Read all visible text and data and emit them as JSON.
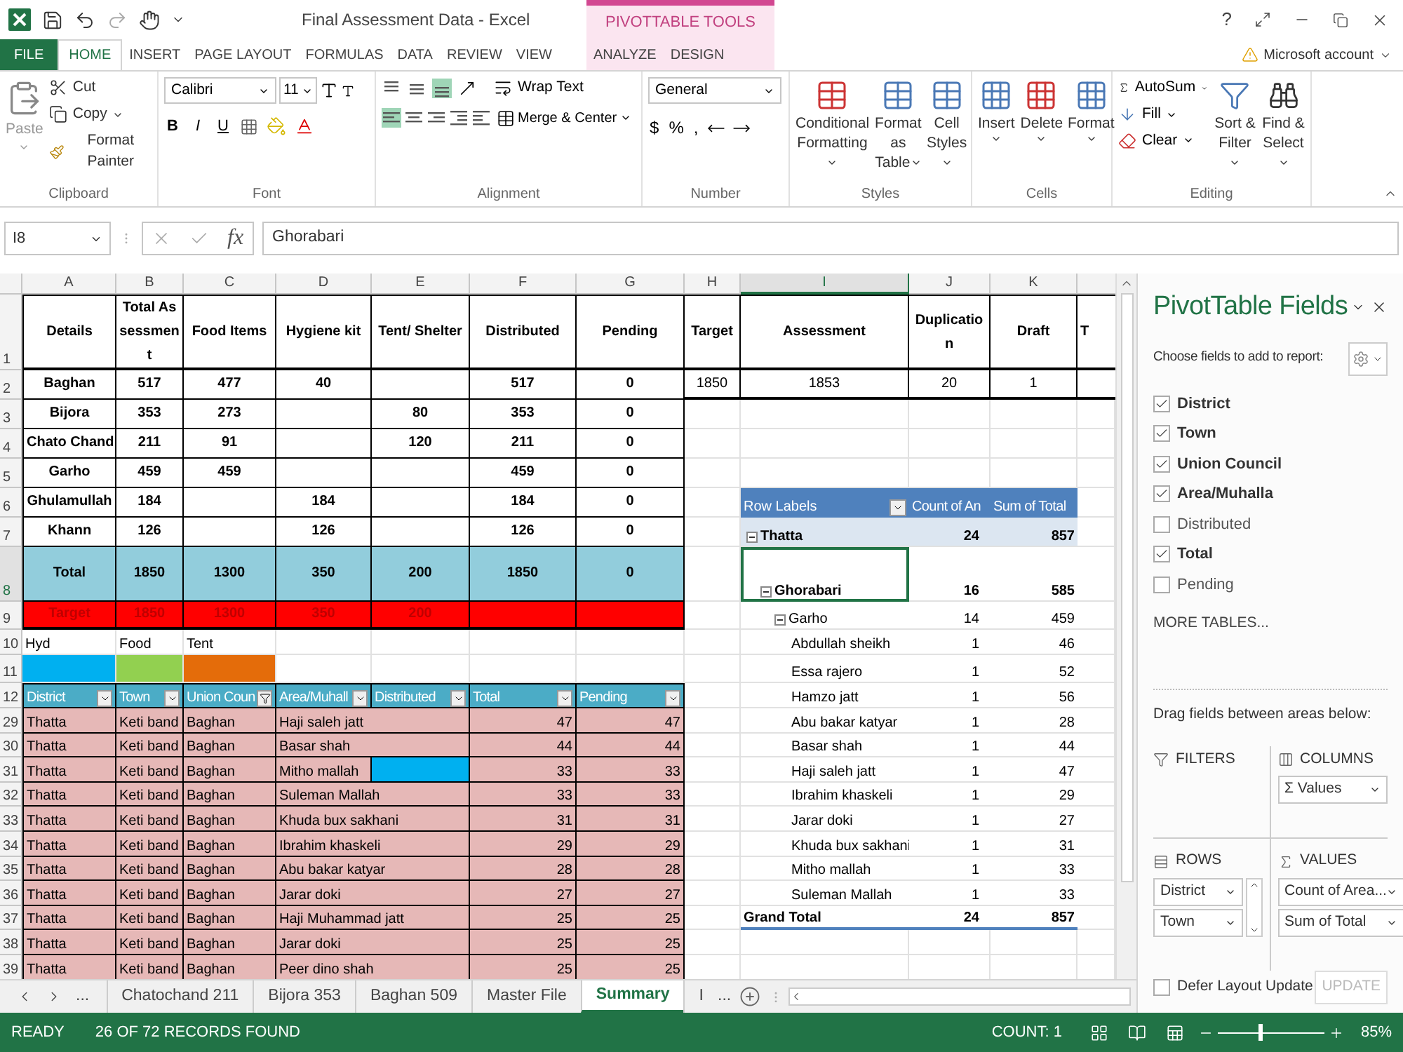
{
  "app": {
    "title": "Final Assessment Data - Excel",
    "contextual_label": "PIVOTTABLE TOOLS",
    "help": "?",
    "account": "Microsoft account"
  },
  "tabs": [
    {
      "label": "FILE",
      "kind": "file",
      "selected": false
    },
    {
      "label": "HOME",
      "kind": "tab",
      "selected": true
    },
    {
      "label": "INSERT",
      "kind": "tab",
      "selected": false
    },
    {
      "label": "PAGE LAYOUT",
      "kind": "tab",
      "selected": false
    },
    {
      "label": "FORMULAS",
      "kind": "tab",
      "selected": false
    },
    {
      "label": "DATA",
      "kind": "tab",
      "selected": false
    },
    {
      "label": "REVIEW",
      "kind": "tab",
      "selected": false
    },
    {
      "label": "VIEW",
      "kind": "tab",
      "selected": false
    },
    {
      "label": "ANALYZE",
      "kind": "contextual",
      "selected": false
    },
    {
      "label": "DESIGN",
      "kind": "contextual",
      "selected": false
    }
  ],
  "ribbon": [
    {
      "kind": "clipboard",
      "label": "Clipboard",
      "items": [
        "Paste",
        "Cut",
        "Copy",
        "Format Painter"
      ]
    },
    {
      "kind": "font",
      "label": "Font",
      "font": "Calibri",
      "size": "11",
      "styles": [
        "B",
        "I",
        "U"
      ]
    },
    {
      "kind": "alignment",
      "label": "Alignment",
      "items": [
        "Wrap Text",
        "Merge & Center"
      ]
    },
    {
      "kind": "number",
      "label": "Number",
      "format": "General",
      "symbols": [
        "$",
        "%",
        ","
      ]
    },
    {
      "kind": "styles",
      "label": "Styles",
      "items": [
        "Conditional Formatting",
        "Format as Table",
        "Cell Styles"
      ]
    },
    {
      "kind": "cells",
      "label": "Cells",
      "items": [
        "Insert",
        "Delete",
        "Format"
      ]
    },
    {
      "kind": "editing",
      "label": "Editing",
      "items": [
        "AutoSum",
        "Fill",
        "Clear",
        "Sort & Filter",
        "Find & Select"
      ]
    }
  ],
  "formula_bar": {
    "name_box": "I8",
    "fx": "fx",
    "value": "Ghorabari"
  },
  "columns": [
    {
      "label": "A",
      "selected": false
    },
    {
      "label": "B",
      "selected": false
    },
    {
      "label": "C",
      "selected": false
    },
    {
      "label": "D",
      "selected": false
    },
    {
      "label": "E",
      "selected": false
    },
    {
      "label": "F",
      "selected": false
    },
    {
      "label": "G",
      "selected": false
    },
    {
      "label": "H",
      "selected": false
    },
    {
      "label": "I",
      "selected": true
    },
    {
      "label": "J",
      "selected": false
    },
    {
      "label": "K",
      "selected": false
    }
  ],
  "rows": [
    {
      "label": "1",
      "selected": false
    },
    {
      "label": "2",
      "selected": false
    },
    {
      "label": "3",
      "selected": false
    },
    {
      "label": "4",
      "selected": false
    },
    {
      "label": "5",
      "selected": false
    },
    {
      "label": "6",
      "selected": false
    },
    {
      "label": "7",
      "selected": false
    },
    {
      "label": "8",
      "selected": true
    },
    {
      "label": "9",
      "selected": false
    },
    {
      "label": "10",
      "selected": false
    },
    {
      "label": "11",
      "selected": false
    },
    {
      "label": "12",
      "selected": false
    },
    {
      "label": "29",
      "selected": false
    },
    {
      "label": "30",
      "selected": false
    },
    {
      "label": "31",
      "selected": false
    },
    {
      "label": "32",
      "selected": false
    },
    {
      "label": "33",
      "selected": false
    },
    {
      "label": "34",
      "selected": false
    },
    {
      "label": "35",
      "selected": false
    },
    {
      "label": "36",
      "selected": false
    },
    {
      "label": "37",
      "selected": false
    },
    {
      "label": "38",
      "selected": false
    },
    {
      "label": "39",
      "selected": false
    }
  ],
  "summary": {
    "header": [
      "Details",
      "Total Assessment",
      "Food Items",
      "Hygiene kit",
      "Tent/ Shelter",
      "Distributed",
      "Pending"
    ],
    "rows": [
      {
        "kind": "data",
        "cells": [
          "Baghan",
          "517",
          "477",
          "40",
          null,
          "517",
          "0"
        ]
      },
      {
        "kind": "data",
        "cells": [
          "Bijora",
          "353",
          "273",
          null,
          "80",
          "353",
          "0"
        ]
      },
      {
        "kind": "data",
        "cells": [
          "Chato Chand",
          "211",
          "91",
          null,
          "120",
          "211",
          "0"
        ]
      },
      {
        "kind": "data",
        "cells": [
          "Garho",
          "459",
          "459",
          null,
          null,
          "459",
          "0"
        ]
      },
      {
        "kind": "data",
        "cells": [
          "Ghulamullah",
          "184",
          null,
          "184",
          null,
          "184",
          "0"
        ]
      },
      {
        "kind": "data",
        "cells": [
          "Khann",
          "126",
          null,
          "126",
          null,
          "126",
          "0"
        ]
      },
      {
        "kind": "total",
        "cells": [
          "Total",
          "1850",
          "1300",
          "350",
          "200",
          "1850",
          "0"
        ]
      },
      {
        "kind": "target",
        "cells": [
          "Target",
          "1850",
          "1300",
          "350",
          "200",
          null,
          null
        ]
      }
    ]
  },
  "targets": {
    "header": [
      "Target",
      "Assessment",
      "Duplication",
      "Draft",
      "T"
    ],
    "values": [
      "1850",
      "1853",
      "20",
      "1"
    ]
  },
  "legend": [
    {
      "label": "Hyd",
      "color": "#00b0f0"
    },
    {
      "label": "Food",
      "color": "#92d050"
    },
    {
      "label": "Tent",
      "color": "#e46c0a"
    }
  ],
  "records": {
    "header": [
      {
        "label": "District",
        "filtered": false
      },
      {
        "label": "Town",
        "filtered": false
      },
      {
        "label": "Union Coun",
        "filtered": true
      },
      {
        "label": "Area/Muhall",
        "filtered": false
      },
      {
        "label": "Distributed",
        "filtered": false
      },
      {
        "label": "Total",
        "filtered": false
      },
      {
        "label": "Pending",
        "filtered": false
      }
    ],
    "rows": [
      {
        "cells": [
          "Thatta",
          "Keti band",
          "Baghan",
          "Haji saleh jatt",
          "47",
          "47"
        ],
        "highlight": false
      },
      {
        "cells": [
          "Thatta",
          "Keti band",
          "Baghan",
          "Basar shah",
          "44",
          "44"
        ],
        "highlight": false
      },
      {
        "cells": [
          "Thatta",
          "Keti band",
          "Baghan",
          "Mitho mallah",
          "33",
          "33"
        ],
        "highlight": true
      },
      {
        "cells": [
          "Thatta",
          "Keti band",
          "Baghan",
          "Suleman Mallah",
          "33",
          "33"
        ],
        "highlight": false
      },
      {
        "cells": [
          "Thatta",
          "Keti band",
          "Baghan",
          "Khuda bux sakhani",
          "31",
          "31"
        ],
        "highlight": false
      },
      {
        "cells": [
          "Thatta",
          "Keti band",
          "Baghan",
          "Ibrahim khaskeli",
          "29",
          "29"
        ],
        "highlight": false
      },
      {
        "cells": [
          "Thatta",
          "Keti band",
          "Baghan",
          "Abu bakar katyar",
          "28",
          "28"
        ],
        "highlight": false
      },
      {
        "cells": [
          "Thatta",
          "Keti band",
          "Baghan",
          "Jarar doki",
          "27",
          "27"
        ],
        "highlight": false
      },
      {
        "cells": [
          "Thatta",
          "Keti band",
          "Baghan",
          "Haji Muhammad jatt",
          "25",
          "25"
        ],
        "highlight": false
      },
      {
        "cells": [
          "Thatta",
          "Keti band",
          "Baghan",
          "Jarar doki",
          "25",
          "25"
        ],
        "highlight": false
      },
      {
        "cells": [
          "Thatta",
          "Keti band",
          "Baghan",
          "Peer dino shah",
          "25",
          "25"
        ],
        "highlight": false
      }
    ]
  },
  "pivot": {
    "header": [
      "Row Labels",
      "Count of An",
      "Sum of Total"
    ],
    "items": [
      {
        "label": "Thatta",
        "count": "24",
        "sum": "857",
        "expanded": true,
        "selected": false,
        "children": [
          {
            "label": "Ghorabari",
            "count": "16",
            "sum": "585",
            "expanded": true,
            "selected": true,
            "children": [
              {
                "label": "Garho",
                "count": "14",
                "sum": "459",
                "expanded": true,
                "selected": false,
                "children": [
                  {
                    "label": "Abdullah sheikh",
                    "count": "1",
                    "sum": "46",
                    "selected": false
                  },
                  {
                    "label": "Essa rajero",
                    "count": "1",
                    "sum": "52",
                    "selected": false
                  },
                  {
                    "label": "Hamzo jatt",
                    "count": "1",
                    "sum": "56",
                    "selected": false
                  },
                  {
                    "label": "Abu bakar katyar",
                    "count": "1",
                    "sum": "28",
                    "selected": false
                  },
                  {
                    "label": "Basar shah",
                    "count": "1",
                    "sum": "44",
                    "selected": false
                  },
                  {
                    "label": "Haji saleh jatt",
                    "count": "1",
                    "sum": "47",
                    "selected": false
                  },
                  {
                    "label": "Ibrahim khaskeli",
                    "count": "1",
                    "sum": "29",
                    "selected": false
                  },
                  {
                    "label": "Jarar doki",
                    "count": "1",
                    "sum": "27",
                    "selected": false
                  },
                  {
                    "label": "Khuda bux sakhani",
                    "count": "1",
                    "sum": "31",
                    "selected": false
                  },
                  {
                    "label": "Mitho mallah",
                    "count": "1",
                    "sum": "33",
                    "selected": false
                  },
                  {
                    "label": "Suleman Mallah",
                    "count": "1",
                    "sum": "33",
                    "selected": false
                  }
                ]
              }
            ]
          }
        ]
      }
    ],
    "grand_total": [
      "Grand Total",
      "24",
      "857"
    ]
  },
  "sheets": {
    "more": "...",
    "tabs": [
      {
        "label": "Chatochand 211",
        "selected": false
      },
      {
        "label": "Bijora 353",
        "selected": false
      },
      {
        "label": "Baghan 509",
        "selected": false
      },
      {
        "label": "Master File",
        "selected": false
      },
      {
        "label": "Summary",
        "selected": true
      },
      {
        "label": "I",
        "selected": false
      }
    ],
    "overflow": "..."
  },
  "pane": {
    "title": "PivotTable Fields",
    "prompt": "Choose fields to add to report:",
    "fields": [
      {
        "label": "District",
        "checked": true
      },
      {
        "label": "Town",
        "checked": true
      },
      {
        "label": "Union Council",
        "checked": true
      },
      {
        "label": "Area/Muhalla",
        "checked": true
      },
      {
        "label": "Distributed",
        "checked": false
      },
      {
        "label": "Total",
        "checked": true
      },
      {
        "label": "Pending",
        "checked": false
      }
    ],
    "more": "MORE TABLES...",
    "drag_hint": "Drag fields between areas below:",
    "areas": [
      {
        "kind": "filters",
        "label": "FILTERS"
      },
      {
        "kind": "columns",
        "label": "COLUMNS",
        "items": [
          "Σ Values"
        ]
      },
      {
        "kind": "rows",
        "label": "ROWS",
        "items": [
          "District",
          "Town"
        ]
      },
      {
        "kind": "values",
        "label": "VALUES",
        "items": [
          "Count of Area...",
          "Sum of Total"
        ]
      }
    ],
    "defer": {
      "label": "Defer Layout Update",
      "checked": false
    },
    "update": {
      "label": "UPDATE",
      "disabled": true
    }
  },
  "status": {
    "mode": "READY",
    "message": "26 OF 72 RECORDS FOUND",
    "count": "COUNT: 1",
    "zoom": "85%",
    "zoom_slider": {
      "level": 0.4
    }
  }
}
